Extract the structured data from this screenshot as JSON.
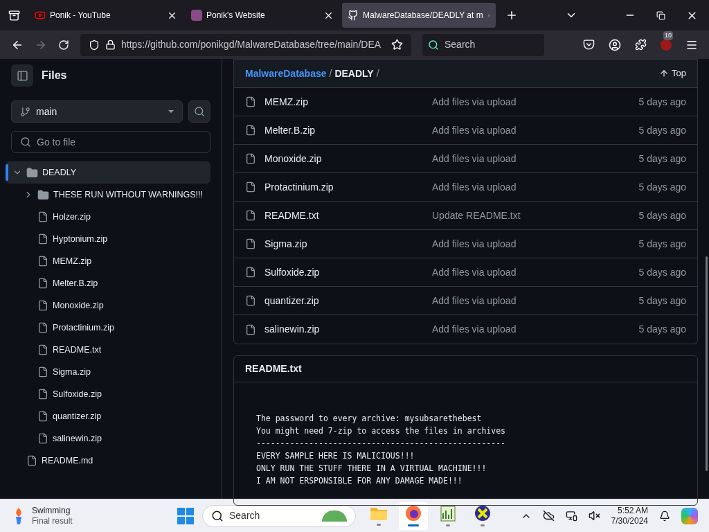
{
  "browser": {
    "tabs": [
      {
        "title": "Ponik - YouTube",
        "kind": "youtube",
        "selected": false
      },
      {
        "title": "Ponik's Website",
        "kind": "site",
        "selected": false
      },
      {
        "title": "MalwareDatabase/DEADLY at m",
        "kind": "github",
        "selected": true
      }
    ],
    "url": "https://github.com/ponikgd/MalwareDatabase/tree/main/DEA",
    "search_placeholder": "Search",
    "extension_badge": "10"
  },
  "sidebar": {
    "title": "Files",
    "branch": "main",
    "filter_placeholder": "Go to file",
    "tree": [
      {
        "name": "DEADLY",
        "kind": "folder",
        "expanded": true,
        "selected": true,
        "children": [
          {
            "name": "THESE RUN WITHOUT WARNINGS!!!",
            "kind": "folder",
            "expanded": false,
            "selected": false
          },
          {
            "name": "Holzer.zip",
            "kind": "file",
            "selected": false
          },
          {
            "name": "Hyptonium.zip",
            "kind": "file",
            "selected": false
          },
          {
            "name": "MEMZ.zip",
            "kind": "file",
            "selected": false
          },
          {
            "name": "Melter.B.zip",
            "kind": "file",
            "selected": false
          },
          {
            "name": "Monoxide.zip",
            "kind": "file",
            "selected": false
          },
          {
            "name": "Protactinium.zip",
            "kind": "file",
            "selected": false
          },
          {
            "name": "README.txt",
            "kind": "file",
            "selected": false
          },
          {
            "name": "Sigma.zip",
            "kind": "file",
            "selected": false
          },
          {
            "name": "Sulfoxide.zip",
            "kind": "file",
            "selected": false
          },
          {
            "name": "quantizer.zip",
            "kind": "file",
            "selected": false
          },
          {
            "name": "salinewin.zip",
            "kind": "file",
            "selected": false
          }
        ]
      },
      {
        "name": "README.md",
        "kind": "file",
        "selected": false
      }
    ]
  },
  "listing": {
    "breadcrumb": [
      "MalwareDatabase",
      "DEADLY"
    ],
    "separator": "/",
    "top_button": "Top",
    "rows": [
      {
        "name": "MEMZ.zip",
        "message": "Add files via upload",
        "time": "5 days ago"
      },
      {
        "name": "Melter.B.zip",
        "message": "Add files via upload",
        "time": "5 days ago"
      },
      {
        "name": "Monoxide.zip",
        "message": "Add files via upload",
        "time": "5 days ago"
      },
      {
        "name": "Protactinium.zip",
        "message": "Add files via upload",
        "time": "5 days ago"
      },
      {
        "name": "README.txt",
        "message": "Update README.txt",
        "time": "5 days ago"
      },
      {
        "name": "Sigma.zip",
        "message": "Add files via upload",
        "time": "5 days ago"
      },
      {
        "name": "Sulfoxide.zip",
        "message": "Add files via upload",
        "time": "5 days ago"
      },
      {
        "name": "quantizer.zip",
        "message": "Add files via upload",
        "time": "5 days ago"
      },
      {
        "name": "salinewin.zip",
        "message": "Add files via upload",
        "time": "5 days ago"
      }
    ]
  },
  "readme": {
    "title": "README.txt",
    "lines": [
      "The password to every archive: mysubsarethebest",
      "You might need 7-zip to access the files in archives",
      "----------------------------------------------------",
      "EVERY SAMPLE HERE IS MALICIOUS!!!",
      "ONLY RUN THE STUFF THERE IN A VIRTUAL MACHINE!!!",
      "I AM NOT ERSPONSIBLE FOR ANY DAMAGE MADE!!!"
    ]
  },
  "taskbar": {
    "weather_title": "Swimming",
    "weather_subtitle": "Final result",
    "search_placeholder": "Search",
    "apps": [
      {
        "kind": "folder",
        "selected": false
      },
      {
        "kind": "browser",
        "selected": true
      },
      {
        "kind": "editor",
        "selected": false
      },
      {
        "kind": "x",
        "selected": false
      }
    ],
    "time": "5:52 AM",
    "date": "7/30/2024"
  }
}
